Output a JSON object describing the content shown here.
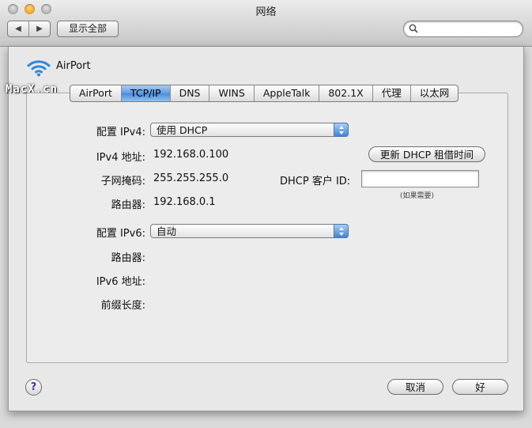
{
  "window": {
    "title": "网络",
    "show_all": "显示全部",
    "back_icon": "chevron-left-icon",
    "forward_icon": "chevron-right-icon",
    "search_icon": "search-icon"
  },
  "sheet": {
    "interface_name": "AirPort",
    "interface_icon": "wifi-icon",
    "watermark": "MacX.cn",
    "tabs": [
      "AirPort",
      "TCP/IP",
      "DNS",
      "WINS",
      "AppleTalk",
      "802.1X",
      "代理",
      "以太网"
    ],
    "active_tab": "TCP/IP",
    "accent_color": "#4a8bda"
  },
  "tcpip": {
    "ipv4_config_label": "配置 IPv4:",
    "ipv4_config_value": "使用 DHCP",
    "ipv4_address_label": "IPv4 地址:",
    "ipv4_address": "192.168.0.100",
    "subnet_label": "子网掩码:",
    "subnet": "255.255.255.0",
    "router_label": "路由器:",
    "router": "192.168.0.1",
    "renew_button": "更新 DHCP 租借时间",
    "dhcp_client_id_label": "DHCP 客户 ID:",
    "dhcp_client_id_value": "",
    "dhcp_client_id_hint": "(如果需要)",
    "ipv6_config_label": "配置 IPv6:",
    "ipv6_config_value": "自动",
    "ipv6_router_label": "路由器:",
    "ipv6_address_label": "IPv6 地址:",
    "prefix_length_label": "前缀长度:"
  },
  "buttons": {
    "help": "?",
    "cancel": "取消",
    "ok": "好"
  }
}
